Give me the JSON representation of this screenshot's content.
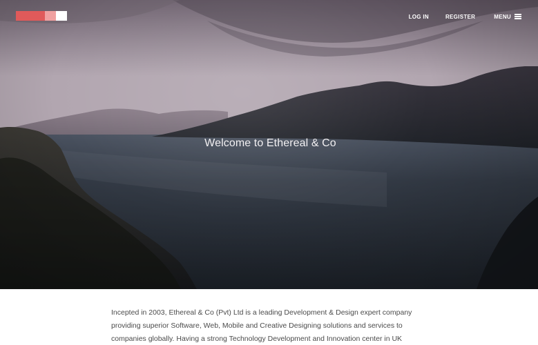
{
  "brand": {
    "logo_colors": [
      "#e05a5a",
      "#f0a0a0",
      "#ffffff"
    ]
  },
  "nav": {
    "login_label": "LOG IN",
    "register_label": "REGISTER",
    "menu_label": "MENU",
    "menu_icon": "hamburger-icon"
  },
  "hero": {
    "title": "Welcome to Ethereal & Co",
    "image": "lake-mountains-at-dusk"
  },
  "intro": {
    "line1": "Incepted in 2003, Ethereal & Co (Pvt) Ltd is a leading Development & Design expert company",
    "line2": "providing superior Software, Web, Mobile and Creative Designing solutions and services to",
    "line3": "companies globally. Having a strong Technology Development and Innovation center in UK"
  },
  "colors": {
    "accent": "#e05a5a",
    "accent_light": "#f0a0a0",
    "text": "#4a4a4a"
  }
}
